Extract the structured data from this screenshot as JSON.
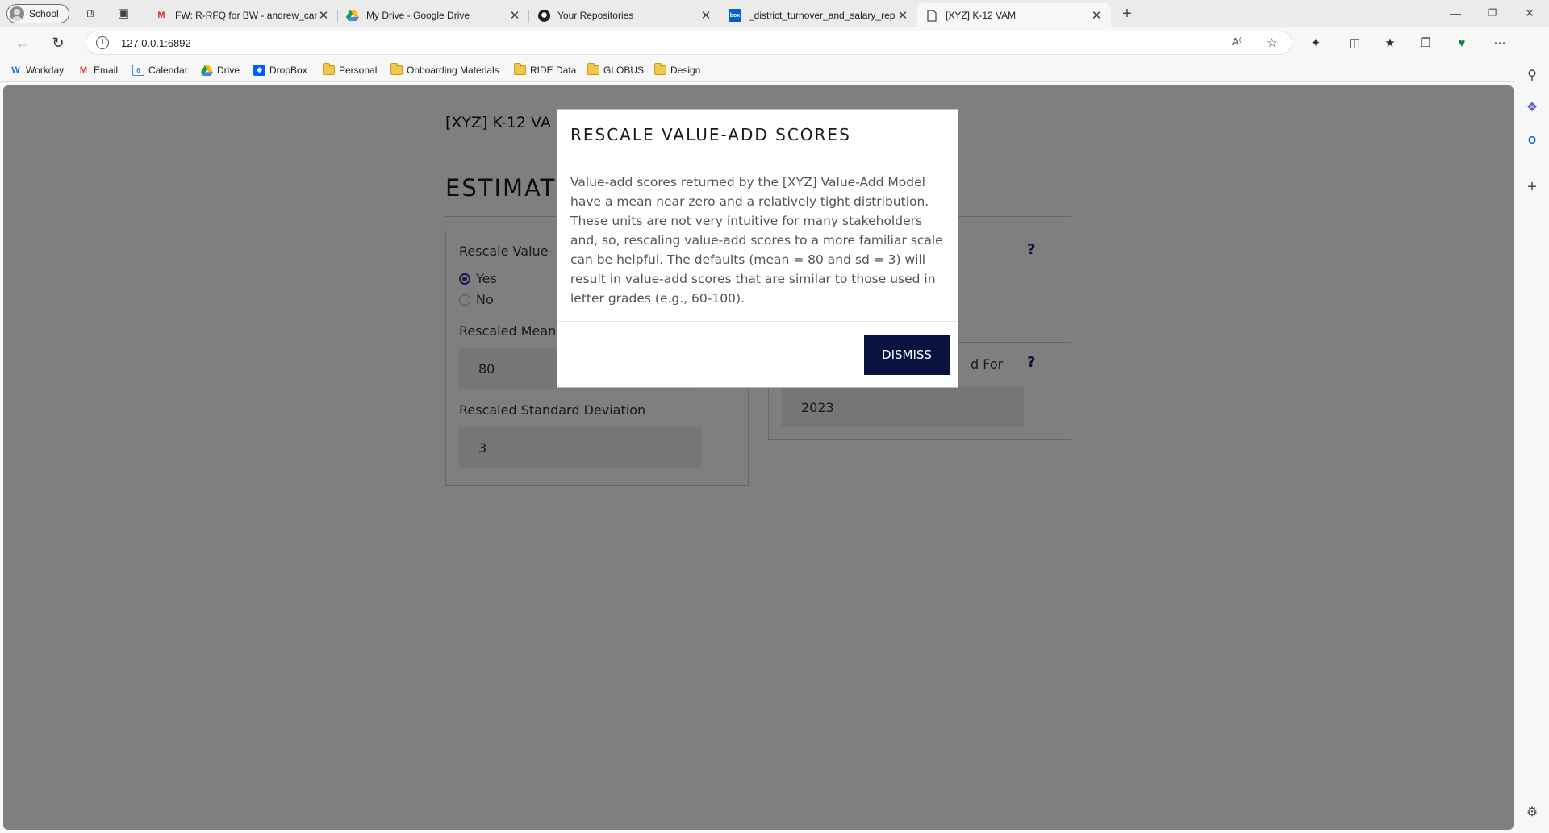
{
  "browser": {
    "profile_label": "School",
    "tabs": [
      {
        "title": "FW: R-RFQ for BW - andrew_cam",
        "favicon": "gmail-icon",
        "active": false
      },
      {
        "title": "My Drive - Google Drive",
        "favicon": "google-drive-icon",
        "active": false
      },
      {
        "title": "Your Repositories",
        "favicon": "github-icon",
        "active": false
      },
      {
        "title": "_district_turnover_and_salary_rep",
        "favicon": "box-icon",
        "active": false
      },
      {
        "title": "[XYZ] K-12 VAM",
        "favicon": "page-icon",
        "active": true
      }
    ],
    "url": "127.0.0.1:6892",
    "bookmarks": [
      {
        "label": "Workday",
        "icon": "workday-icon"
      },
      {
        "label": "Email",
        "icon": "gmail-icon"
      },
      {
        "label": "Calendar",
        "icon": "calendar-icon"
      },
      {
        "label": "Drive",
        "icon": "google-drive-icon"
      },
      {
        "label": "DropBox",
        "icon": "dropbox-icon"
      },
      {
        "label": "Personal",
        "icon": "folder-icon"
      },
      {
        "label": "Onboarding Materials",
        "icon": "folder-icon"
      },
      {
        "label": "RIDE Data",
        "icon": "folder-icon"
      },
      {
        "label": "GLOBUS",
        "icon": "folder-icon"
      },
      {
        "label": "Design",
        "icon": "folder-icon"
      }
    ]
  },
  "app": {
    "title_visible": "[XYZ] K-12 VA",
    "section_visible": "ESTIMAT",
    "rescale": {
      "label_visible": "Rescale Value-",
      "options": [
        "Yes",
        "No"
      ],
      "selected": "Yes"
    },
    "mean": {
      "label_visible": "Rescaled Mean",
      "value": "80"
    },
    "sd": {
      "label": "Rescaled Standard Deviation",
      "value": "3"
    },
    "right_panel_2": {
      "label_visible": "d For",
      "value": "2023"
    },
    "help_mark": "?"
  },
  "modal": {
    "title": "RESCALE VALUE-ADD SCORES",
    "body": "Value-add scores returned by the [XYZ] Value-Add Model have a mean near zero and a relatively tight distribution. These units are not very intuitive for many stakeholders and, so, rescaling value-add scores to a more familiar scale can be helpful. The defaults (mean = 80 and sd = 3) will result in value-add scores that are similar to those used in letter grades (e.g., 60-100).",
    "dismiss_label": "DISMISS"
  },
  "colors": {
    "accent_navy": "#0a1240",
    "help_blue": "#1a237e",
    "overlay": "rgba(0,0,0,0.5)"
  }
}
